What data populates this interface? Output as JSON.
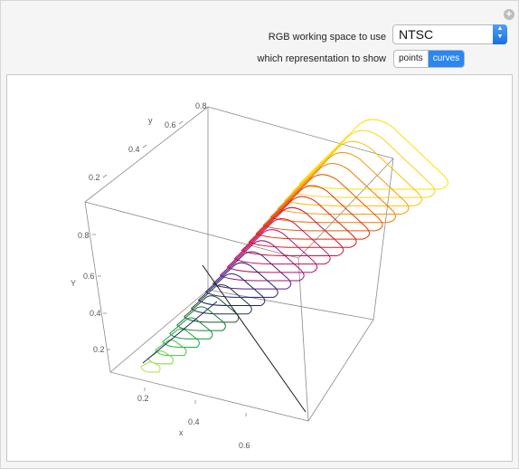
{
  "controls": {
    "working_space_label": "RGB working space to use",
    "working_space_value": "NTSC",
    "representation_label": "which representation to show",
    "representation_options": [
      "points",
      "curves"
    ],
    "representation_selected": "curves"
  },
  "plot": {
    "y_axis_label": "y",
    "Y_axis_label": "Y",
    "x_axis_label": "x",
    "y_ticks": [
      "0.2",
      "0.4",
      "0.6",
      "0.8"
    ],
    "Y_ticks": [
      "0.2",
      "0.4",
      "0.6",
      "0.8"
    ],
    "x_ticks": [
      "0.2",
      "0.4",
      "0.6"
    ],
    "curve_colors": [
      "#ffe000",
      "#f7d41a",
      "#ffc000",
      "#f79a00",
      "#ef7a00",
      "#e45a00",
      "#dd3300",
      "#d61a1a",
      "#cc1230",
      "#c81050",
      "#b0106e",
      "#9a1080",
      "#5a1a86",
      "#2a1e70",
      "#1e2860",
      "#203a3a",
      "#1f5a30",
      "#177a3a",
      "#14903c",
      "#1fae3c",
      "#3ac83a",
      "#76d840",
      "#a8e440"
    ]
  }
}
